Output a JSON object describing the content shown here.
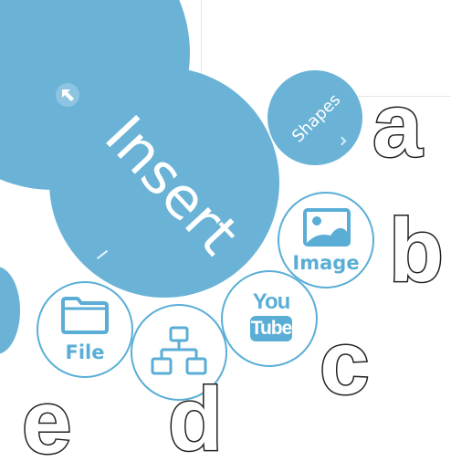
{
  "colors": {
    "accent": "#5aaed6",
    "accent_fill": "#6ab3d7"
  },
  "insert_menu": {
    "title": "Insert",
    "items": {
      "shapes": {
        "label": "Shapes",
        "icon": "shapes-submenu-chevron-icon"
      },
      "image": {
        "label": "Image",
        "icon": "image-icon"
      },
      "youtube": {
        "label": "YouTube",
        "icon": "youtube-icon"
      },
      "diagram": {
        "label": "",
        "icon": "diagram-hierarchy-icon"
      },
      "file": {
        "label": "File",
        "icon": "folder-icon"
      }
    },
    "back": {
      "icon": "back-arrow-icon"
    }
  },
  "annotations": {
    "a": "a",
    "b": "b",
    "c": "c",
    "d": "d",
    "e": "e"
  }
}
